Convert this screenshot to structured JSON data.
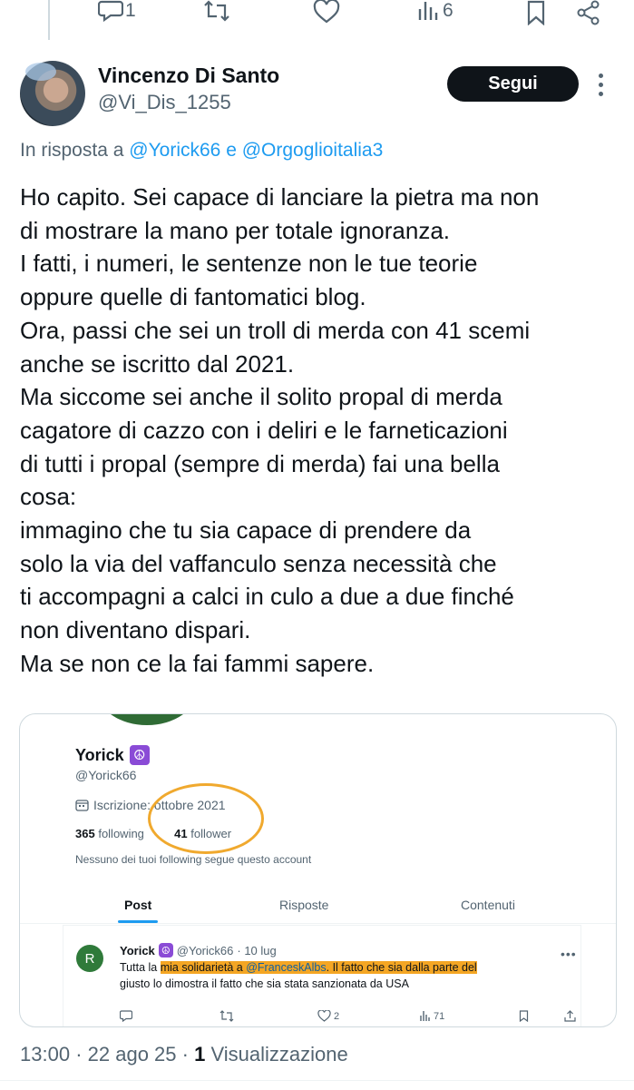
{
  "action_bar": {
    "reply_count": "1",
    "views_count": "6"
  },
  "author": {
    "name": "Vincenzo Di Santo",
    "handle": "@Vi_Dis_1255",
    "follow_label": "Segui"
  },
  "reply_to": {
    "prefix": "In risposta a",
    "user1": "@Yorick66",
    "conj": "e",
    "user2": "@Orgoglioitalia3"
  },
  "tweet_lines": [
    "Ho capito. Sei capace di lanciare la pietra ma non",
    "di mostrare la mano per totale ignoranza.",
    "I fatti, i numeri, le sentenze non le tue teorie",
    "oppure quelle di fantomatici blog.",
    "Ora, passi che sei un troll di merda con 41 scemi",
    "anche se iscritto dal 2021.",
    "Ma siccome sei anche il solito propal di merda",
    "cagatore di cazzo con i deliri e le farneticazioni",
    "di tutti i propal (sempre di merda) fai una bella",
    "cosa:",
    "immagino che tu sia capace di prendere da",
    "solo la via del vaffanculo senza necessità che",
    "ti accompagni a calci in culo a due a due finché",
    "non diventano dispari.",
    "Ma se non ce la fai fammi sapere."
  ],
  "card": {
    "name": "Yorick",
    "badge": "☮",
    "handle": "@Yorick66",
    "joined": "Iscrizione: ottobre 2021",
    "following_count": "365",
    "following_label": "following",
    "followers_count": "41",
    "followers_label": "follower",
    "note": "Nessuno dei tuoi following segue questo account",
    "tabs": [
      "Post",
      "Risposte",
      "Contenuti"
    ],
    "post": {
      "avatar_letter": "R",
      "name": "Yorick",
      "handle": "@Yorick66",
      "date": "· 10 lug",
      "text1_a": "Tutta la ",
      "text1_hl": "mia solidarietà a ",
      "mention": "@FranceskAlbs",
      "text1_b": ". Il fatto che sia dalla parte del",
      "text2": "giusto lo dimostra il fatto che sia stata sanzionata da USA",
      "likes": "2",
      "views": "71"
    }
  },
  "meta": {
    "time": "13:00",
    "sep1": "·",
    "date": "22 ago 25",
    "sep2": "·",
    "views_count": "1",
    "views_label": "Visualizzazione"
  }
}
